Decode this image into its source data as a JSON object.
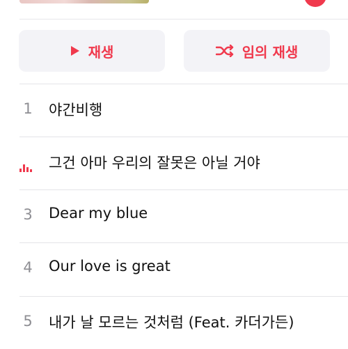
{
  "actions": {
    "play_label": "재생",
    "shuffle_label": "임의 재생",
    "accent_color": "#f0394d"
  },
  "tracks": [
    {
      "number": "1",
      "title": "야간비행",
      "playing": false
    },
    {
      "number": "",
      "title": "그건 아마 우리의 잘못은 아닐 거야",
      "playing": true
    },
    {
      "number": "3",
      "title": "Dear my blue",
      "playing": false
    },
    {
      "number": "4",
      "title": "Our love is great",
      "playing": false
    },
    {
      "number": "5",
      "title": "내가 날 모르는 것처럼 (Feat. 카더가든)",
      "playing": false
    }
  ]
}
